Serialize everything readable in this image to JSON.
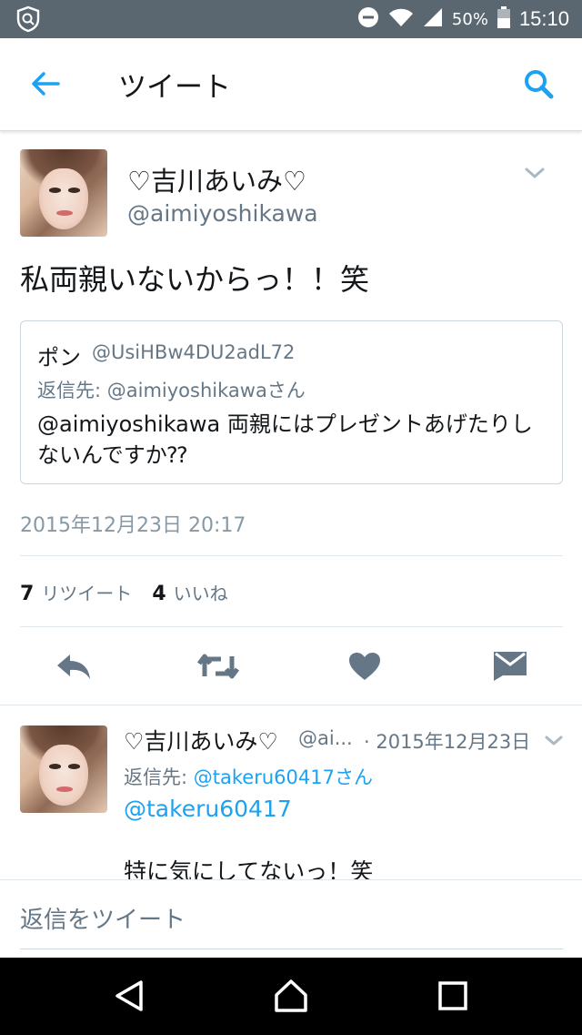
{
  "status_bar": {
    "battery_pct": "50%",
    "time": "15:10"
  },
  "app_bar": {
    "title": "ツイート"
  },
  "tweet": {
    "author_name": "♡吉川あいみ♡",
    "author_handle": "@aimiyoshikawa",
    "text": "私両親いないからっ！！笑",
    "quoted": {
      "name": "ポン",
      "handle": "@UsiHBw4DU2adL72",
      "reply_to": "返信先: @aimiyoshikawaさん",
      "text": "@aimiyoshikawa 両親にはプレゼントあげたりしないんですか⁇"
    },
    "timestamp": "2015年12月23日 20:17",
    "retweet_count": "7",
    "retweet_label": "リツイート",
    "like_count": "4",
    "like_label": "いいね"
  },
  "reply": {
    "author_name": "♡吉川あいみ♡",
    "author_handle": "@ai...",
    "date": "· 2015年12月23日",
    "reply_to_prefix": "返信先: ",
    "reply_to_link": "@takeru60417さん",
    "mention": "@takeru60417",
    "text": "特に気にしてないっ！笑"
  },
  "compose": {
    "placeholder": "返信をツイート"
  },
  "colors": {
    "accent": "#1da1f2",
    "icon": "#657786",
    "status_bar": "#5b6770"
  },
  "icons": [
    "shield-icon",
    "dnd-icon",
    "wifi-icon",
    "signal-icon",
    "battery-icon",
    "back-arrow-icon",
    "search-icon",
    "chevron-down-icon",
    "reply-icon",
    "retweet-icon",
    "heart-icon",
    "message-icon",
    "nav-back-icon",
    "nav-home-icon",
    "nav-recents-icon"
  ]
}
